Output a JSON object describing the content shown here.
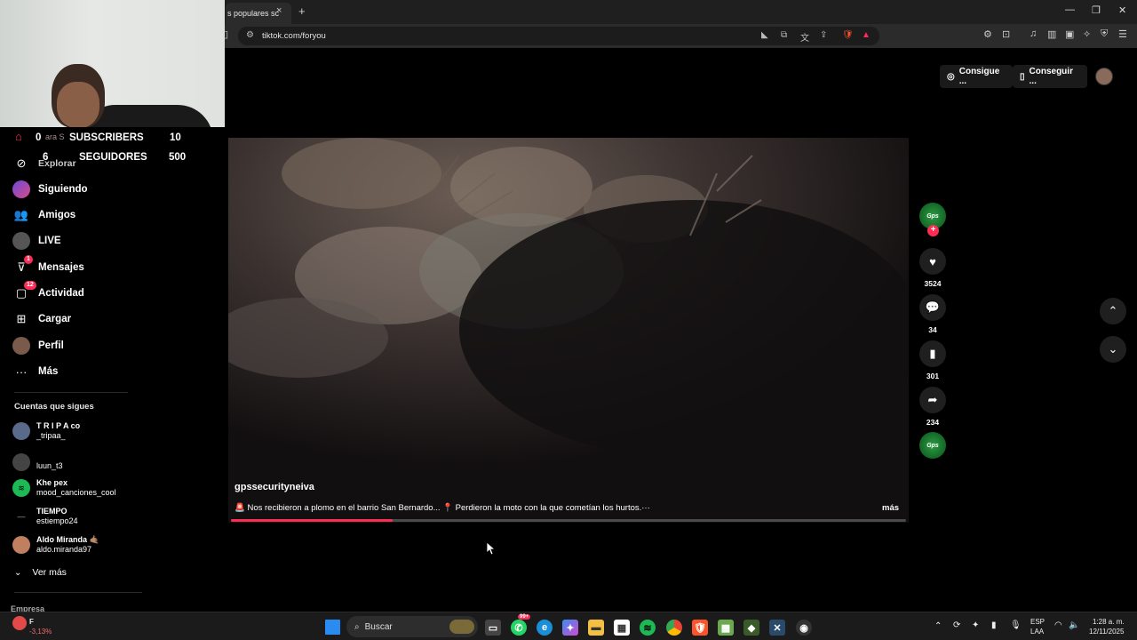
{
  "browser": {
    "tab_title": "s populares sc",
    "tab_close": "×",
    "new_tab": "+",
    "url": "tiktok.com/foryou",
    "window_controls": [
      "—",
      "❐",
      "✕"
    ]
  },
  "overlay": {
    "row1": {
      "left": "0",
      "faded": "ara S",
      "label": "SUBSCRIBERS",
      "right": "10"
    },
    "row2": {
      "left": "6",
      "label": "SEGUIDORES",
      "right": "500"
    }
  },
  "sidebar": {
    "nav": [
      {
        "label": "Explorar",
        "icon": "compass-icon"
      },
      {
        "label": "Siguiendo",
        "icon": "following-avatar-icon"
      },
      {
        "label": "Amigos",
        "icon": "friends-icon"
      },
      {
        "label": "LIVE",
        "icon": "live-icon"
      },
      {
        "label": "Mensajes",
        "icon": "messages-icon",
        "badge": "1"
      },
      {
        "label": "Actividad",
        "icon": "activity-icon",
        "badge": "12"
      },
      {
        "label": "Cargar",
        "icon": "upload-icon"
      },
      {
        "label": "Perfil",
        "icon": "profile-avatar-icon"
      },
      {
        "label": "Más",
        "icon": "more-dots-icon"
      }
    ],
    "following_title": "Cuentas que sigues",
    "following": [
      {
        "name": "T R I P A co",
        "handle": "_tripaa_"
      },
      {
        "name": "luun_t3",
        "handle": ""
      },
      {
        "name": "Khe pex",
        "handle": "mood_canciones_cool"
      },
      {
        "name": "TIEMPO",
        "handle": "estiempo24"
      },
      {
        "name": "Aldo Miranda 🤙🏽",
        "handle": "aldo.miranda97"
      }
    ],
    "see_more": "Ver más",
    "footer": "Empresa"
  },
  "header_buttons": {
    "coins": "Consigue ...",
    "app": "Conseguir ..."
  },
  "video": {
    "author": "gpssecurityneiva",
    "description": "🚨 Nos recibieron a plomo en el barrio San Bernardo... 📍 Perdieron la moto con la que cometían los hurtos.···",
    "more": "más",
    "progress": 0.24
  },
  "actions": {
    "likes": "3524",
    "comments": "34",
    "saves": "301",
    "shares": "234",
    "avatar_text": "Gps",
    "plus": "+"
  },
  "taskbar": {
    "search_label": "Buscar",
    "whatsapp_badge": "99+",
    "stock_change": "-3,13%",
    "stock_label": "F",
    "language": "ESP",
    "layout": "LAA",
    "time": "1:28 a. m.",
    "date": "12/11/2025"
  },
  "colors": {
    "accent": "#fe2c55",
    "background": "#000000",
    "chrome": "#2b2b2b"
  }
}
